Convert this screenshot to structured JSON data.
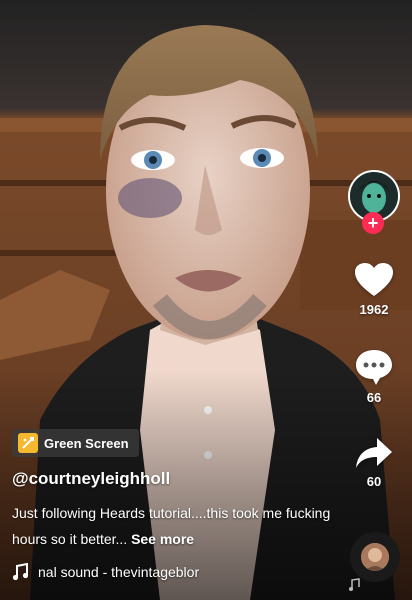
{
  "effect": {
    "label": "Green Screen",
    "icon": "green-screen-effect-icon"
  },
  "creator": {
    "username": "@courtneyleighholl",
    "avatar": "creator-avatar",
    "follow_icon": "+"
  },
  "caption": {
    "text": "Just following Heards tutorial....this took me fucking hours so it better...",
    "see_more": "See more"
  },
  "sound": {
    "text": "nal sound - thevintageblor",
    "icon": "music-note-icon"
  },
  "actions": {
    "likes": "1962",
    "comments": "66",
    "shares": "60"
  },
  "colors": {
    "accent": "#fe2c55",
    "effect_badge": "#f5b82e"
  }
}
